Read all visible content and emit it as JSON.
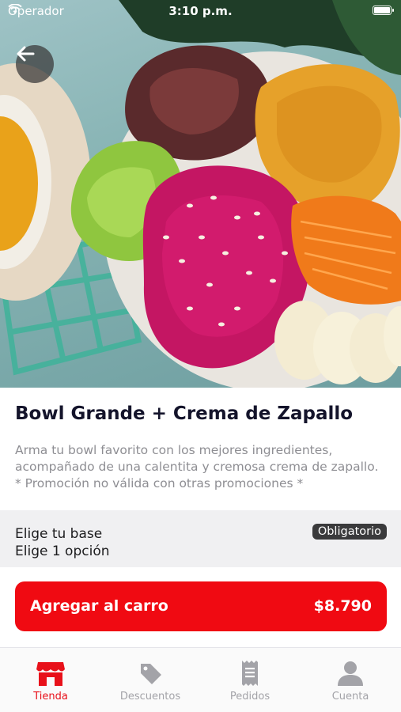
{
  "status_bar": {
    "carrier": "Operador",
    "time": "3:10 p.m."
  },
  "product": {
    "title": "Bowl Grande + Crema de Zapallo",
    "description_lines": [
      "Arma tu bowl favorito con los mejores ingredientes,",
      "acompañado de una calentita y cremosa crema de zapallo.",
      "* Promoción no válida con otras promociones *"
    ]
  },
  "options": {
    "title": "Elige tu base",
    "subtitle": "Elige 1 opción",
    "badge": "Obligatorio"
  },
  "cart_button": {
    "label": "Agregar al carro",
    "price": "$8.790"
  },
  "tabs": [
    {
      "label": "Tienda",
      "icon": "store-icon",
      "active": true
    },
    {
      "label": "Descuentos",
      "icon": "tag-icon",
      "active": false
    },
    {
      "label": "Pedidos",
      "icon": "receipt-icon",
      "active": false
    },
    {
      "label": "Cuenta",
      "icon": "user-icon",
      "active": false
    }
  ],
  "colors": {
    "accent": "#f00a12",
    "tab_active": "#e8111a",
    "tab_inactive": "#a3a3a8"
  }
}
